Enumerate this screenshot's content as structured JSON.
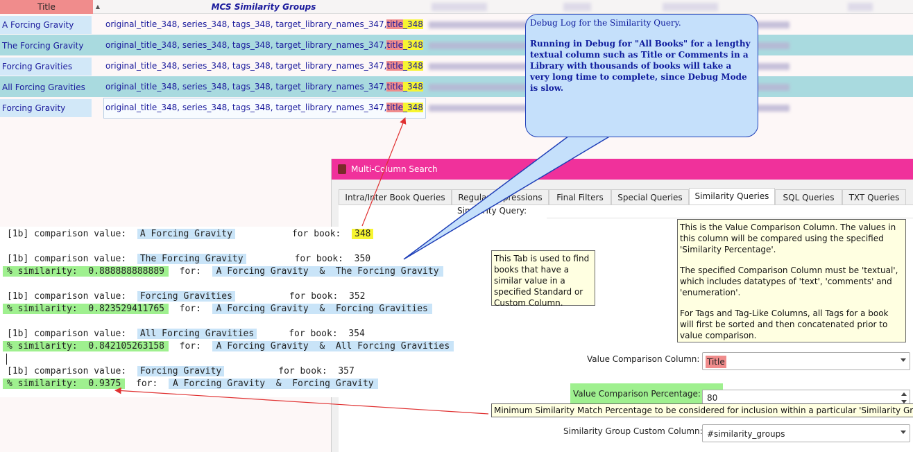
{
  "grid": {
    "header": {
      "title": "Title",
      "mcs": "MCS Similarity Groups"
    },
    "rows": [
      {
        "title": "A Forcing Gravity",
        "mcs_prefix": "original_title_348, series_348, tags_348, target_library_names_347, ",
        "mcs_red": "title",
        "mcs_yel": "_348"
      },
      {
        "title": "The Forcing Gravity",
        "mcs_prefix": "original_title_348, series_348, tags_348, target_library_names_347, ",
        "mcs_red": "title",
        "mcs_yel": "_348"
      },
      {
        "title": "Forcing Gravities",
        "mcs_prefix": "original_title_348, series_348, tags_348, target_library_names_347, ",
        "mcs_red": "title",
        "mcs_yel": "_348"
      },
      {
        "title": "All Forcing Gravities",
        "mcs_prefix": "original_title_348, series_348, tags_348, target_library_names_347, ",
        "mcs_red": "title",
        "mcs_yel": "_348"
      },
      {
        "title": "Forcing Gravity",
        "mcs_prefix": "original_title_348, series_348, tags_348, target_library_names_347, ",
        "mcs_red": "title",
        "mcs_yel": "_348"
      }
    ]
  },
  "callout": {
    "title": "Debug Log for the Similarity Query.",
    "body": "Running in Debug for \"All Books\" for a lengthy textual column such as Title or Comments in a Library with thousands of books will take a very long time to complete, since Debug Mode is slow."
  },
  "dialog": {
    "title": "Multi-Column Search",
    "tabs": [
      "Intra/Inter Book Queries",
      "Regular Expressions",
      "Final Filters",
      "Special Queries",
      "Similarity Queries",
      "SQL Queries",
      "TXT Queries"
    ],
    "active_tab": "Similarity Queries",
    "similarity_query_label": "Similarity Query:",
    "tab_tip": "This Tab is used to find books that have a similar value in a specified Standard or Custom Column.",
    "column_tip": {
      "p1": "This is the Value Comparison Column. The values in this column will be compared using the specified 'Similarity Percentage'.",
      "p2": "The specified Comparison Column must be 'textual', which includes datatypes of 'text', 'comments' and 'enumeration'.",
      "p3": "For Tags and Tag-Like Columns, all Tags for a book will first be sorted and then concatenated prior to value comparison."
    },
    "value_column_label": "Value Comparison Column:",
    "value_column_value": "Title",
    "percentage_label": "Value Comparison Percentage:",
    "percentage_value": "80",
    "percentage_tip": "Minimum Similarity Match Percentage to be considered for inclusion within a particular 'Similarity Group'.",
    "group_column_label": "Similarity Group Custom Column:",
    "group_column_value": "#similarity_groups"
  },
  "log": {
    "cmp_label": "[1b] comparison value:  ",
    "for_book": "for book:  ",
    "sim_label": "% similarity:  ",
    "for_label": "for:  ",
    "amp": "  &  ",
    "entries": [
      {
        "value": "A Forcing Gravity",
        "book": "348"
      },
      {
        "value": "The Forcing Gravity",
        "book": "350",
        "sim": "0.888888888889",
        "a": "A Forcing Gravity",
        "b": "The Forcing Gravity"
      },
      {
        "value": "Forcing Gravities",
        "book": "352",
        "sim": "0.823529411765",
        "a": "A Forcing Gravity",
        "b": "Forcing Gravities"
      },
      {
        "value": "All Forcing Gravities",
        "book": "354",
        "sim": "0.842105263158",
        "a": "A Forcing Gravity",
        "b": "All Forcing Gravities"
      },
      {
        "value": "Forcing Gravity",
        "book": "357",
        "sim": "0.9375",
        "a": "A Forcing Gravity",
        "b": "Forcing Gravity"
      }
    ]
  },
  "colors": {
    "accent": "#f0319b",
    "callout_fill": "#c5e0fb",
    "highlight_yellow": "#f7f531",
    "highlight_green": "#9ff08f",
    "highlight_red": "#f08c8c"
  }
}
